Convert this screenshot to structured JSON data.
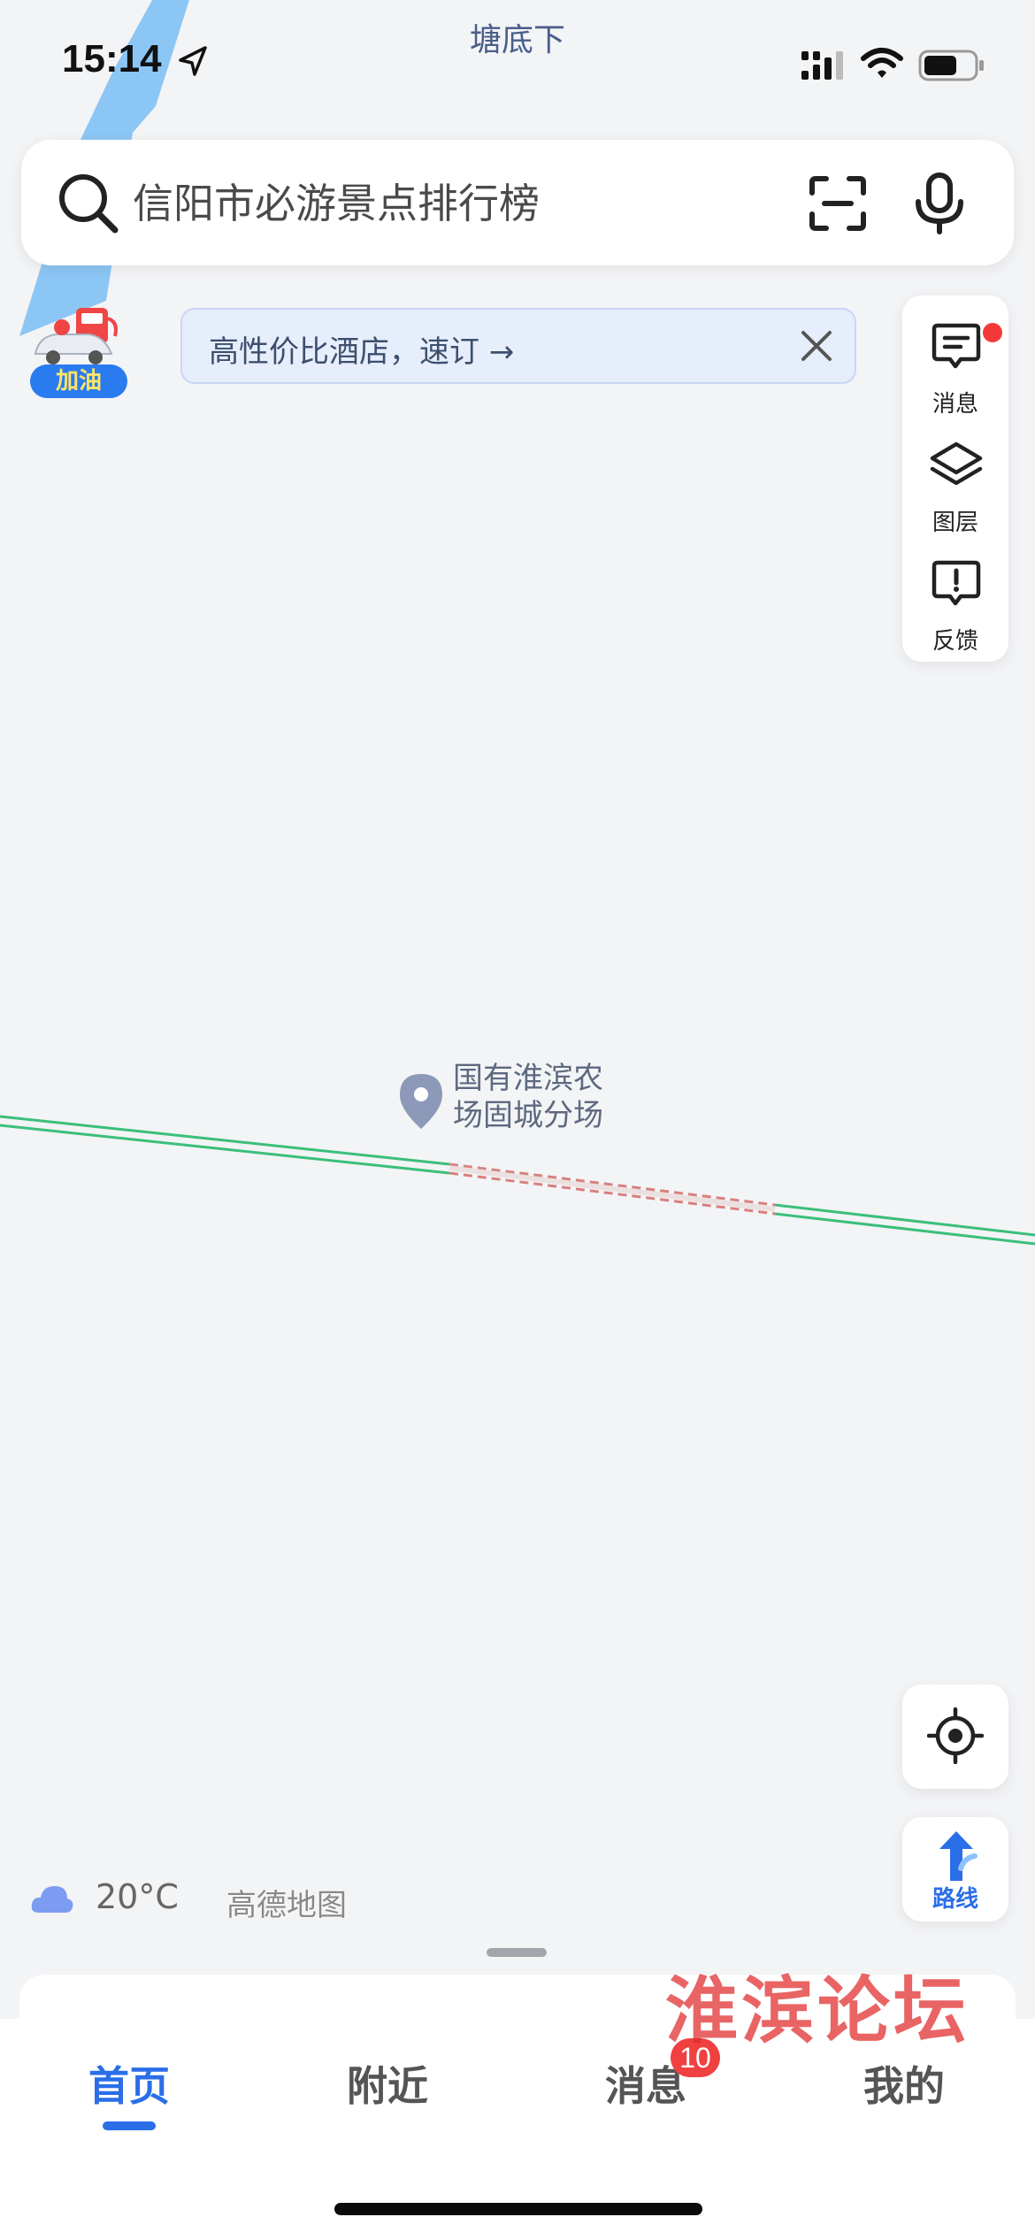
{
  "status_bar": {
    "time": "15:14",
    "place": "塘底下"
  },
  "search": {
    "placeholder": "信阳市必游景点排行榜"
  },
  "fuel_badge": {
    "label": "加油"
  },
  "hotel_banner": {
    "text": "高性价比酒店，速订 →"
  },
  "tools": [
    {
      "label": "消息",
      "icon": "message-icon",
      "has_dot": true
    },
    {
      "label": "图层",
      "icon": "layers-icon"
    },
    {
      "label": "反馈",
      "icon": "feedback-icon"
    }
  ],
  "poi": {
    "line1": "国有淮滨农",
    "line2": "场固城分场"
  },
  "route_button": {
    "label": "路线"
  },
  "weather": {
    "temperature": "20°C"
  },
  "map_logo": "高德地图",
  "watermark": "淮滨论坛",
  "tabs": [
    {
      "label": "首页",
      "active": true
    },
    {
      "label": "附近"
    },
    {
      "label": "消息",
      "badge": "10"
    },
    {
      "label": "我的"
    }
  ],
  "colors": {
    "accent": "#2a6ee8",
    "road_green": "#3bbf7a",
    "road_red": "#d88080",
    "badge_red": "#f04040"
  }
}
